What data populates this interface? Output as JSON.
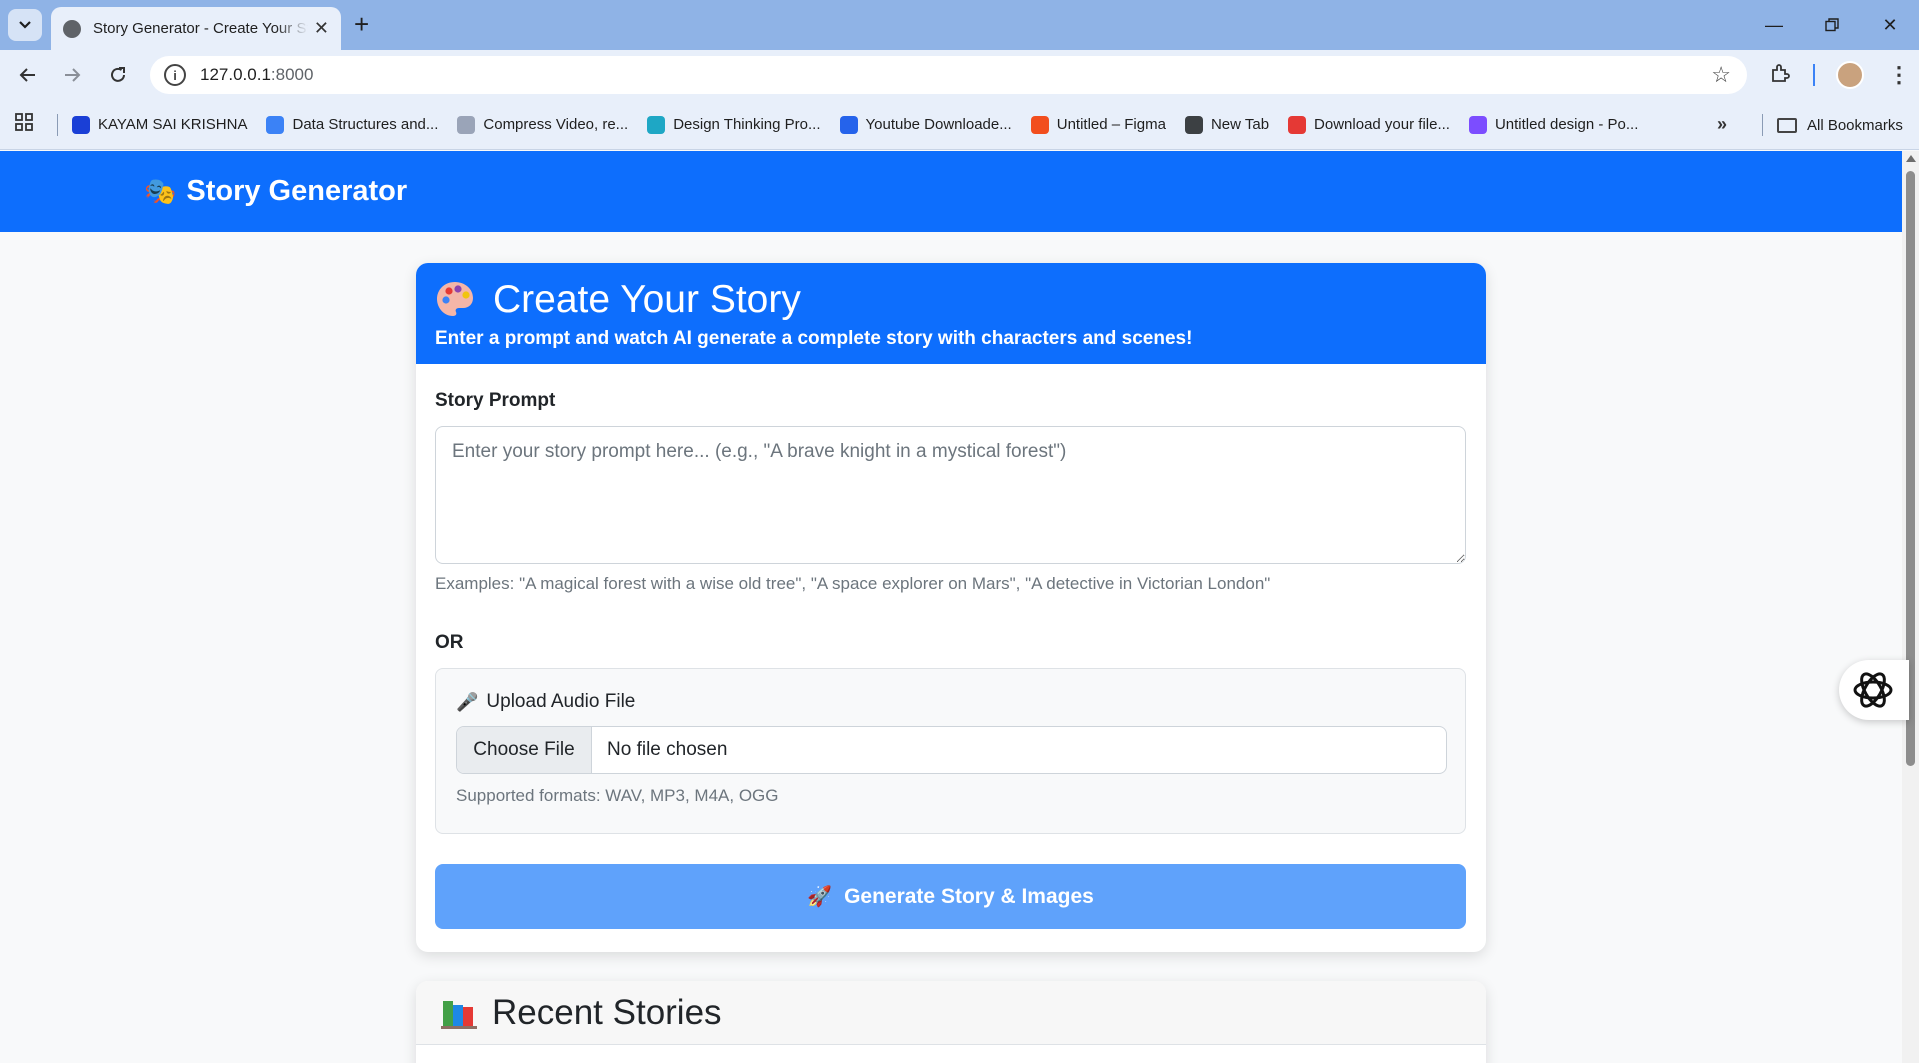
{
  "browser": {
    "tab_title": "Story Generator - Create Your Story",
    "url_host": "127.0.0.1",
    "url_port": ":8000",
    "bookmarks": [
      {
        "label": "KAYAM SAI KRISHNA",
        "color": "#1a3fd6"
      },
      {
        "label": "Data Structures and...",
        "color": "#3b82f6"
      },
      {
        "label": "Compress Video, re...",
        "color": "#9aa4b8"
      },
      {
        "label": "Design Thinking Pro...",
        "color": "#1ea7c5"
      },
      {
        "label": "Youtube Downloade...",
        "color": "#2563eb"
      },
      {
        "label": "Untitled – Figma",
        "color": "#f24e1e"
      },
      {
        "label": "New Tab",
        "color": "#3c4043"
      },
      {
        "label": "Download your file...",
        "color": "#e53935"
      },
      {
        "label": "Untitled design - Po...",
        "color": "#7c4dff"
      }
    ],
    "all_bookmarks": "All Bookmarks"
  },
  "navbar": {
    "brand": "Story Generator",
    "brand_icon": "theater-masks-icon"
  },
  "create_card": {
    "title": "Create Your Story",
    "subtitle": "Enter a prompt and watch AI generate a complete story with characters and scenes!",
    "prompt_label": "Story Prompt",
    "prompt_value": "",
    "prompt_placeholder": "Enter your story prompt here... (e.g., \"A brave knight in a mystical forest\")",
    "examples": "Examples: \"A magical forest with a wise old tree\", \"A space explorer on Mars\", \"A detective in Victorian London\"",
    "or_label": "OR",
    "upload_label": "Upload Audio File",
    "choose_file": "Choose File",
    "no_file": "No file chosen",
    "formats": "Supported formats: WAV, MP3, M4A, OGG",
    "generate_button": "Generate Story & Images"
  },
  "recent": {
    "title": "Recent Stories"
  },
  "colors": {
    "primary": "#0d6efd",
    "button_disabled": "#5fa2fb"
  }
}
